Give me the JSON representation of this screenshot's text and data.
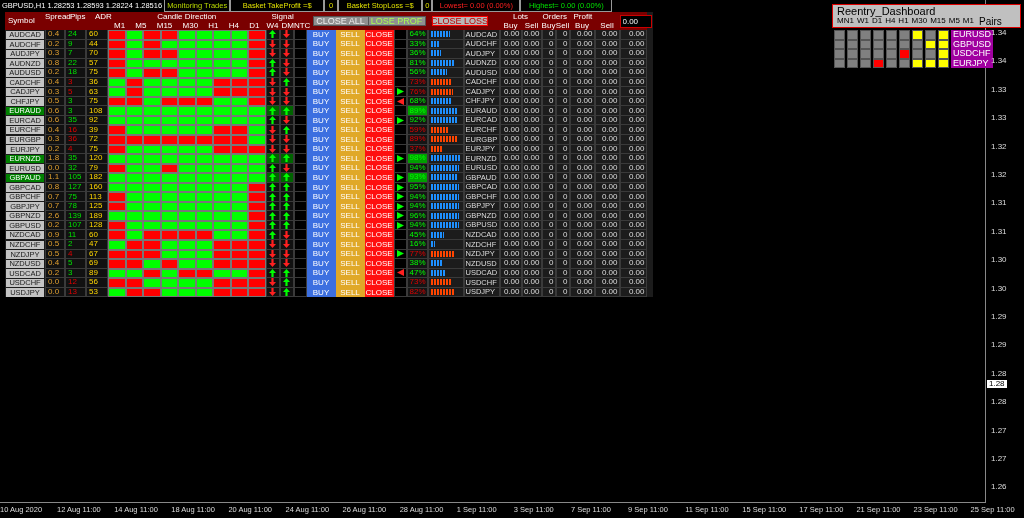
{
  "topbar": {
    "symbol_info": "GBPUSD,H1 1.28253 1.28593 1.28224 1.28516",
    "monitoring": "Monitoring Trades",
    "take_profit_label": "Basket TakeProfit =$",
    "take_profit_value": "0",
    "stop_loss_label": "Basket StopLoss =$",
    "stop_loss_value": "0",
    "lowest": "Lowest= 0.00 (0.00%)",
    "highest": "Highest= 0.00 (0.00%)"
  },
  "header": {
    "symbol": "Symbol",
    "spread": "Spread",
    "pips": "Pips",
    "adr": "ADR",
    "candle_direction": "Candle Direction",
    "timeframes": [
      "M1",
      "M5",
      "M15",
      "M30",
      "H1",
      "H4",
      "D1"
    ],
    "signal": "Signal",
    "signal_columns": [
      "W4",
      "DMNTC"
    ],
    "close_all": "CLOSE ALL",
    "close_profit": "LOSE PROF",
    "close_loss": "CLOSE LOSS",
    "lots": "Lots",
    "orders": "Orders",
    "profit": "Profit",
    "subheaders": [
      "Buy",
      "Sell",
      "Buy",
      "Sell",
      "Buy",
      "Sell"
    ],
    "amount": "0.00"
  },
  "rows": [
    {
      "symbol": "AUDCAD",
      "highlight": false,
      "spread": "0.4",
      "pips": "24",
      "pips_up": true,
      "adr": "60",
      "candles": [
        false,
        true,
        false,
        false,
        true,
        true,
        true,
        true,
        false
      ],
      "w4_up": true,
      "d_up": false,
      "actions": [
        "BUY",
        "SELL",
        "CLOSE"
      ],
      "buy_signal": false,
      "sell_signal": false,
      "percent": "64%",
      "bull": true,
      "level": 0.64,
      "pair": "AUDCAD",
      "values": [
        "0.00",
        "0.00",
        "0",
        "0",
        "0.00",
        "0.00",
        "0.00"
      ]
    },
    {
      "symbol": "AUDCHF",
      "highlight": false,
      "spread": "0.2",
      "pips": "9",
      "pips_up": true,
      "adr": "44",
      "candles": [
        false,
        true,
        false,
        true,
        true,
        true,
        true,
        true,
        false
      ],
      "w4_up": false,
      "d_up": false,
      "actions": [
        "BUY",
        "SELL",
        "CLOSE"
      ],
      "buy_signal": false,
      "sell_signal": false,
      "percent": "33%",
      "bull": true,
      "level": 0.33,
      "pair": "AUDCHF",
      "values": [
        "0.00",
        "0.00",
        "0",
        "0",
        "0.00",
        "0.00",
        "0.00"
      ]
    },
    {
      "symbol": "AUDJPY",
      "highlight": false,
      "spread": "0.3",
      "pips": "7",
      "pips_up": true,
      "adr": "70",
      "candles": [
        false,
        true,
        false,
        false,
        true,
        true,
        true,
        true,
        false
      ],
      "w4_up": false,
      "d_up": false,
      "actions": [
        "BUY",
        "SELL",
        "CLOSE"
      ],
      "buy_signal": false,
      "sell_signal": false,
      "percent": "36%",
      "bull": true,
      "level": 0.36,
      "pair": "AUDJPY",
      "values": [
        "0.00",
        "0.00",
        "0",
        "0",
        "0.00",
        "0.00",
        "0.00"
      ]
    },
    {
      "symbol": "AUDNZD",
      "highlight": false,
      "spread": "0.8",
      "pips": "22",
      "pips_up": true,
      "adr": "57",
      "candles": [
        false,
        true,
        true,
        true,
        true,
        true,
        true,
        true,
        false
      ],
      "w4_up": true,
      "d_up": false,
      "actions": [
        "BUY",
        "SELL",
        "CLOSE"
      ],
      "buy_signal": false,
      "sell_signal": false,
      "percent": "81%",
      "bull": true,
      "level": 0.81,
      "pair": "AUDNZD",
      "values": [
        "0.00",
        "0.00",
        "0",
        "0",
        "0.00",
        "0.00",
        "0.00"
      ]
    },
    {
      "symbol": "AUDUSD",
      "highlight": false,
      "spread": "0.2",
      "pips": "18",
      "pips_up": true,
      "adr": "75",
      "candles": [
        false,
        true,
        false,
        false,
        true,
        true,
        true,
        true,
        false
      ],
      "w4_up": true,
      "d_up": false,
      "actions": [
        "BUY",
        "SELL",
        "CLOSE"
      ],
      "buy_signal": false,
      "sell_signal": false,
      "percent": "56%",
      "bull": true,
      "level": 0.56,
      "pair": "AUDUSD",
      "values": [
        "0.00",
        "0.00",
        "0",
        "0",
        "0.00",
        "0.00",
        "0.00"
      ]
    },
    {
      "symbol": "CADCHF",
      "highlight": false,
      "spread": "0.4",
      "pips": "3",
      "pips_up": false,
      "adr": "36",
      "candles": [
        true,
        false,
        true,
        true,
        true,
        true,
        false,
        false,
        false
      ],
      "w4_up": false,
      "d_up": true,
      "actions": [
        "BUY",
        "SELL",
        "CLOSE"
      ],
      "buy_signal": false,
      "sell_signal": false,
      "percent": "73%",
      "bull": false,
      "level": 0.73,
      "pair": "CADCHF",
      "values": [
        "0.00",
        "0.00",
        "0",
        "0",
        "0.00",
        "0.00",
        "0.00"
      ]
    },
    {
      "symbol": "CADJPY",
      "highlight": false,
      "spread": "0.3",
      "pips": "5",
      "pips_up": false,
      "adr": "63",
      "candles": [
        true,
        false,
        true,
        true,
        true,
        true,
        false,
        false,
        false
      ],
      "w4_up": false,
      "d_up": false,
      "actions": [
        "BUY",
        "SELL",
        "CLOSE"
      ],
      "buy_signal": true,
      "sell_signal": false,
      "percent": "76%",
      "bull": false,
      "level": 0.76,
      "pair": "CADJPY",
      "values": [
        "0.00",
        "0.00",
        "0",
        "0",
        "0.00",
        "0.00",
        "0.00"
      ]
    },
    {
      "symbol": "CHFJPY",
      "highlight": false,
      "spread": "0.5",
      "pips": "3",
      "pips_up": true,
      "adr": "75",
      "candles": [
        false,
        false,
        true,
        false,
        false,
        false,
        true,
        true,
        false
      ],
      "w4_up": false,
      "d_up": false,
      "actions": [
        "BUY",
        "SELL",
        "CLOSE"
      ],
      "buy_signal": false,
      "sell_signal": true,
      "percent": "68%",
      "bull": true,
      "level": 0.68,
      "pair": "CHFJPY",
      "values": [
        "0.00",
        "0.00",
        "0",
        "0",
        "0.00",
        "0.00",
        "0.00"
      ]
    },
    {
      "symbol": "EURAUD",
      "highlight": true,
      "spread": "0.6",
      "pips": "3",
      "pips_up": true,
      "adr": "108",
      "candles": [
        true,
        true,
        true,
        true,
        true,
        true,
        true,
        true,
        true
      ],
      "w4_up": true,
      "d_up": true,
      "actions": [
        "BUY",
        "SELL",
        "CLOSE"
      ],
      "buy_signal": false,
      "sell_signal": false,
      "percent": "89%",
      "bull": true,
      "level": 0.89,
      "pair": "EURAUD",
      "values": [
        "0.00",
        "0.00",
        "0",
        "0",
        "0.00",
        "0.00",
        "0.00"
      ]
    },
    {
      "symbol": "EURCAD",
      "highlight": false,
      "spread": "0.6",
      "pips": "35",
      "pips_up": true,
      "adr": "92",
      "candles": [
        true,
        true,
        true,
        true,
        true,
        true,
        true,
        true,
        true
      ],
      "w4_up": true,
      "d_up": false,
      "actions": [
        "BUY",
        "SELL",
        "CLOSE"
      ],
      "buy_signal": true,
      "sell_signal": false,
      "percent": "92%",
      "bull": true,
      "level": 0.92,
      "pair": "EURCAD",
      "values": [
        "0.00",
        "0.00",
        "0",
        "0",
        "0.00",
        "0.00",
        "0.00"
      ]
    },
    {
      "symbol": "EURCHF",
      "highlight": false,
      "spread": "0.4",
      "pips": "16",
      "pips_up": false,
      "adr": "39",
      "candles": [
        false,
        true,
        true,
        true,
        true,
        true,
        false,
        false,
        true
      ],
      "w4_up": false,
      "d_up": true,
      "actions": [
        "BUY",
        "SELL",
        "CLOSE"
      ],
      "buy_signal": false,
      "sell_signal": false,
      "percent": "59%",
      "bull": false,
      "level": 0.59,
      "pair": "EURCHF",
      "values": [
        "0.00",
        "0.00",
        "0",
        "0",
        "0.00",
        "0.00",
        "0.00"
      ]
    },
    {
      "symbol": "EURGBP",
      "highlight": false,
      "spread": "0.3",
      "pips": "36",
      "pips_up": false,
      "adr": "72",
      "candles": [
        false,
        false,
        false,
        false,
        false,
        false,
        false,
        false,
        true
      ],
      "w4_up": false,
      "d_up": false,
      "actions": [
        "BUY",
        "SELL",
        "CLOSE"
      ],
      "buy_signal": false,
      "sell_signal": false,
      "percent": "89%",
      "bull": false,
      "level": 0.89,
      "pair": "EURGBP",
      "values": [
        "0.00",
        "0.00",
        "0",
        "0",
        "0.00",
        "0.00",
        "0.00"
      ]
    },
    {
      "symbol": "EURJPY",
      "highlight": false,
      "spread": "0.2",
      "pips": "4",
      "pips_up": false,
      "adr": "75",
      "candles": [
        false,
        true,
        true,
        true,
        true,
        true,
        false,
        false,
        false
      ],
      "w4_up": false,
      "d_up": false,
      "actions": [
        "BUY",
        "SELL",
        "CLOSE"
      ],
      "buy_signal": false,
      "sell_signal": false,
      "percent": "37%",
      "bull": false,
      "level": 0.37,
      "pair": "EURJPY",
      "values": [
        "0.00",
        "0.00",
        "0",
        "0",
        "0.00",
        "0.00",
        "0.00"
      ]
    },
    {
      "symbol": "EURNZD",
      "highlight": true,
      "spread": "1.8",
      "pips": "35",
      "pips_up": true,
      "adr": "120",
      "candles": [
        true,
        true,
        true,
        true,
        true,
        true,
        true,
        true,
        true
      ],
      "w4_up": true,
      "d_up": true,
      "actions": [
        "BUY",
        "SELL",
        "CLOSE"
      ],
      "buy_signal": true,
      "sell_signal": false,
      "percent": "98%",
      "bull": true,
      "level": 0.98,
      "pair": "EURNZD",
      "values": [
        "0.00",
        "0.00",
        "0",
        "0",
        "0.00",
        "0.00",
        "0.00"
      ]
    },
    {
      "symbol": "EURUSD",
      "highlight": false,
      "spread": "0.0",
      "pips": "32",
      "pips_up": true,
      "adr": "79",
      "candles": [
        false,
        true,
        true,
        false,
        true,
        true,
        true,
        true,
        true
      ],
      "w4_up": true,
      "d_up": false,
      "actions": [
        "BUY",
        "SELL",
        "CLOSE"
      ],
      "buy_signal": false,
      "sell_signal": false,
      "percent": "94%",
      "bull": true,
      "level": 0.94,
      "pair": "EURUSD",
      "values": [
        "0.00",
        "0.00",
        "0",
        "0",
        "0.00",
        "0.00",
        "0.00"
      ]
    },
    {
      "symbol": "GBPAUD",
      "highlight": true,
      "spread": "1.1",
      "pips": "105",
      "pips_up": true,
      "adr": "182",
      "candles": [
        true,
        true,
        true,
        true,
        true,
        true,
        true,
        true,
        true
      ],
      "w4_up": true,
      "d_up": true,
      "actions": [
        "BUY",
        "SELL",
        "CLOSE"
      ],
      "buy_signal": true,
      "sell_signal": false,
      "percent": "93%",
      "bull": true,
      "level": 0.93,
      "pair": "GBPAUD",
      "values": [
        "0.00",
        "0.00",
        "0",
        "0",
        "0.00",
        "0.00",
        "0.00"
      ]
    },
    {
      "symbol": "GBPCAD",
      "highlight": false,
      "spread": "0.8",
      "pips": "127",
      "pips_up": true,
      "adr": "160",
      "candles": [
        true,
        true,
        true,
        true,
        true,
        true,
        true,
        true,
        false
      ],
      "w4_up": true,
      "d_up": true,
      "actions": [
        "BUY",
        "SELL",
        "CLOSE"
      ],
      "buy_signal": true,
      "sell_signal": false,
      "percent": "95%",
      "bull": true,
      "level": 0.95,
      "pair": "GBPCAD",
      "values": [
        "0.00",
        "0.00",
        "0",
        "0",
        "0.00",
        "0.00",
        "0.00"
      ]
    },
    {
      "symbol": "GBPCHF",
      "highlight": false,
      "spread": "0.7",
      "pips": "75",
      "pips_up": true,
      "adr": "113",
      "candles": [
        false,
        true,
        true,
        true,
        true,
        true,
        true,
        true,
        false
      ],
      "w4_up": true,
      "d_up": true,
      "actions": [
        "BUY",
        "SELL",
        "CLOSE"
      ],
      "buy_signal": true,
      "sell_signal": false,
      "percent": "94%",
      "bull": true,
      "level": 0.94,
      "pair": "GBPCHF",
      "values": [
        "0.00",
        "0.00",
        "0",
        "0",
        "0.00",
        "0.00",
        "0.00"
      ]
    },
    {
      "symbol": "GBPJPY",
      "highlight": false,
      "spread": "0.7",
      "pips": "78",
      "pips_up": true,
      "adr": "125",
      "candles": [
        false,
        true,
        true,
        true,
        true,
        true,
        true,
        true,
        false
      ],
      "w4_up": true,
      "d_up": true,
      "actions": [
        "BUY",
        "SELL",
        "CLOSE"
      ],
      "buy_signal": true,
      "sell_signal": false,
      "percent": "94%",
      "bull": true,
      "level": 0.94,
      "pair": "GBPJPY",
      "values": [
        "0.00",
        "0.00",
        "0",
        "0",
        "0.00",
        "0.00",
        "0.00"
      ]
    },
    {
      "symbol": "GBPNZD",
      "highlight": false,
      "spread": "2.6",
      "pips": "139",
      "pips_up": true,
      "adr": "189",
      "candles": [
        true,
        true,
        true,
        true,
        true,
        true,
        true,
        true,
        false
      ],
      "w4_up": true,
      "d_up": true,
      "actions": [
        "BUY",
        "SELL",
        "CLOSE"
      ],
      "buy_signal": true,
      "sell_signal": false,
      "percent": "96%",
      "bull": true,
      "level": 0.96,
      "pair": "GBPNZD",
      "values": [
        "0.00",
        "0.00",
        "0",
        "0",
        "0.00",
        "0.00",
        "0.00"
      ]
    },
    {
      "symbol": "GBPUSD",
      "highlight": false,
      "spread": "0.2",
      "pips": "107",
      "pips_up": true,
      "adr": "128",
      "candles": [
        false,
        true,
        true,
        true,
        true,
        true,
        true,
        true,
        false
      ],
      "w4_up": true,
      "d_up": true,
      "actions": [
        "BUY",
        "SELL",
        "CLOSE"
      ],
      "buy_signal": true,
      "sell_signal": false,
      "percent": "94%",
      "bull": true,
      "level": 0.94,
      "pair": "GBPUSD",
      "values": [
        "0.00",
        "0.00",
        "0",
        "0",
        "0.00",
        "0.00",
        "0.00"
      ]
    },
    {
      "symbol": "NZDCAD",
      "highlight": false,
      "spread": "0.9",
      "pips": "11",
      "pips_up": true,
      "adr": "60",
      "candles": [
        false,
        true,
        false,
        false,
        false,
        false,
        true,
        true,
        false
      ],
      "w4_up": true,
      "d_up": false,
      "actions": [
        "BUY",
        "SELL",
        "CLOSE"
      ],
      "buy_signal": false,
      "sell_signal": false,
      "percent": "45%",
      "bull": true,
      "level": 0.45,
      "pair": "NZDCAD",
      "values": [
        "0.00",
        "0.00",
        "0",
        "0",
        "0.00",
        "0.00",
        "0.00"
      ]
    },
    {
      "symbol": "NZDCHF",
      "highlight": false,
      "spread": "0.5",
      "pips": "2",
      "pips_up": true,
      "adr": "47",
      "candles": [
        true,
        false,
        false,
        true,
        true,
        true,
        false,
        false,
        false
      ],
      "w4_up": false,
      "d_up": false,
      "actions": [
        "BUY",
        "SELL",
        "CLOSE"
      ],
      "buy_signal": false,
      "sell_signal": false,
      "percent": "16%",
      "bull": true,
      "level": 0.16,
      "pair": "NZDCHF",
      "values": [
        "0.00",
        "0.00",
        "0",
        "0",
        "0.00",
        "0.00",
        "0.00"
      ]
    },
    {
      "symbol": "NZDJPY",
      "highlight": false,
      "spread": "0.5",
      "pips": "4",
      "pips_up": false,
      "adr": "67",
      "candles": [
        false,
        false,
        false,
        true,
        true,
        true,
        false,
        false,
        false
      ],
      "w4_up": false,
      "d_up": false,
      "actions": [
        "BUY",
        "SELL",
        "CLOSE"
      ],
      "buy_signal": true,
      "sell_signal": false,
      "percent": "77%",
      "bull": false,
      "level": 0.77,
      "pair": "NZDJPY",
      "values": [
        "0.00",
        "0.00",
        "0",
        "0",
        "0.00",
        "0.00",
        "0.00"
      ]
    },
    {
      "symbol": "NZDUSD",
      "highlight": false,
      "spread": "0.4",
      "pips": "5",
      "pips_up": true,
      "adr": "69",
      "candles": [
        false,
        false,
        true,
        false,
        true,
        true,
        false,
        false,
        false
      ],
      "w4_up": false,
      "d_up": false,
      "actions": [
        "BUY",
        "SELL",
        "CLOSE"
      ],
      "buy_signal": false,
      "sell_signal": false,
      "percent": "38%",
      "bull": true,
      "level": 0.38,
      "pair": "NZDUSD",
      "values": [
        "0.00",
        "0.00",
        "0",
        "0",
        "0.00",
        "0.00",
        "0.00"
      ]
    },
    {
      "symbol": "USDCAD",
      "highlight": false,
      "spread": "0.2",
      "pips": "3",
      "pips_up": true,
      "adr": "89",
      "candles": [
        true,
        true,
        false,
        true,
        false,
        false,
        true,
        true,
        false
      ],
      "w4_up": true,
      "d_up": true,
      "actions": [
        "BUY",
        "SELL",
        "CLOSE"
      ],
      "buy_signal": false,
      "sell_signal": true,
      "percent": "47%",
      "bull": true,
      "level": 0.47,
      "pair": "USDCAD",
      "values": [
        "0.00",
        "0.00",
        "0",
        "0",
        "0.00",
        "0.00",
        "0.00"
      ]
    },
    {
      "symbol": "USDCHF",
      "highlight": false,
      "spread": "0.0",
      "pips": "12",
      "pips_up": false,
      "adr": "56",
      "candles": [
        false,
        false,
        true,
        true,
        true,
        true,
        false,
        false,
        false
      ],
      "w4_up": false,
      "d_up": true,
      "actions": [
        "BUY",
        "SELL",
        "CLOSE"
      ],
      "buy_signal": false,
      "sell_signal": false,
      "percent": "73%",
      "bull": false,
      "level": 0.73,
      "pair": "USDCHF",
      "values": [
        "0.00",
        "0.00",
        "0",
        "0",
        "0.00",
        "0.00",
        "0.00"
      ]
    },
    {
      "symbol": "USDJPY",
      "highlight": false,
      "spread": "0.0",
      "pips": "13",
      "pips_up": false,
      "adr": "53",
      "candles": [
        true,
        false,
        false,
        true,
        true,
        true,
        false,
        false,
        false
      ],
      "w4_up": false,
      "d_up": true,
      "actions": [
        "BUY",
        "SELL",
        "CLOSE"
      ],
      "buy_signal": false,
      "sell_signal": false,
      "percent": "82%",
      "bull": false,
      "level": 0.82,
      "pair": "USDJPY",
      "values": [
        "0.00",
        "0.00",
        "0",
        "0",
        "0.00",
        "0.00",
        "0.00"
      ]
    }
  ],
  "reentry": {
    "title": "Reentry_Dashboard",
    "timeframes": [
      "MN1",
      "W1",
      "D1",
      "H4",
      "H1",
      "M30",
      "M15",
      "M5",
      "M1"
    ],
    "pairs_label": "Pairs",
    "rows": [
      {
        "pair": "EURUSD",
        "cells": [
          {
            "color": "#808080"
          },
          {
            "color": "#808080"
          },
          {
            "color": "#808080"
          },
          {
            "color": "#808080"
          },
          {
            "color": "#808080"
          },
          {
            "color": "#808080"
          },
          {
            "color": "#ffff00"
          },
          {
            "color": "#808080"
          },
          {
            "color": "#ffff00"
          }
        ]
      },
      {
        "pair": "GBPUSD",
        "cells": [
          {
            "color": "#808080"
          },
          {
            "color": "#808080"
          },
          {
            "color": "#808080"
          },
          {
            "color": "#808080"
          },
          {
            "color": "#808080"
          },
          {
            "color": "#808080"
          },
          {
            "color": "#808080"
          },
          {
            "color": "#ffff00"
          },
          {
            "color": "#ffff00"
          }
        ]
      },
      {
        "pair": "USDCHF",
        "cells": [
          {
            "color": "#808080"
          },
          {
            "color": "#808080"
          },
          {
            "color": "#808080"
          },
          {
            "color": "#808080"
          },
          {
            "color": "#808080"
          },
          {
            "color": "#ff0000"
          },
          {
            "color": "#808080"
          },
          {
            "color": "#808080"
          },
          {
            "color": "#ffff00"
          }
        ]
      },
      {
        "pair": "EURJPY",
        "cells": [
          {
            "color": "#808080"
          },
          {
            "color": "#808080"
          },
          {
            "color": "#808080"
          },
          {
            "color": "#ff0000"
          },
          {
            "color": "#808080"
          },
          {
            "color": "#808080"
          },
          {
            "color": "#ffff00"
          },
          {
            "color": "#ffff00"
          },
          {
            "color": "#ffff00"
          }
        ]
      }
    ]
  },
  "price_axis": {
    "labels": [
      "1.34",
      "1.34",
      "1.33",
      "1.33",
      "1.32",
      "1.32",
      "1.31",
      "1.31",
      "1.30",
      "1.30",
      "1.29",
      "1.29",
      "1.28",
      "1.28",
      "1.27",
      "1.27",
      "1.26"
    ],
    "current": "1.28"
  },
  "time_axis": [
    "10 Aug 2020",
    "12 Aug 11:00",
    "14 Aug 11:00",
    "18 Aug 11:00",
    "20 Aug 11:00",
    "24 Aug 11:00",
    "26 Aug 11:00",
    "28 Aug 11:00",
    "1 Sep 11:00",
    "3 Sep 11:00",
    "7 Sep 11:00",
    "9 Sep 11:00",
    "11 Sep 11:00",
    "15 Sep 11:00",
    "17 Sep 11:00",
    "21 Sep 11:00",
    "23 Sep 11:00",
    "25 Sep 11:00"
  ]
}
